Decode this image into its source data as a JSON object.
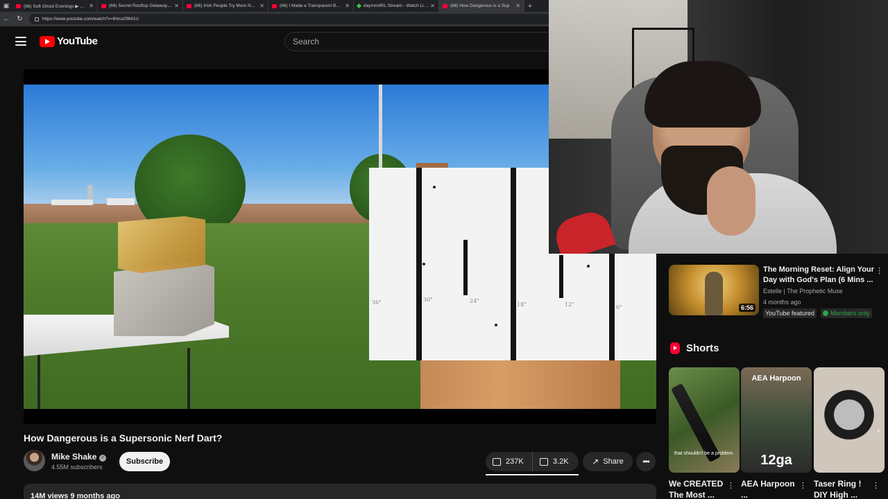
{
  "browser": {
    "tabs": [
      {
        "label": "(66) Soft Ghost Evenings ▶ Lofi B",
        "fav": "red"
      },
      {
        "label": "(66) Secret Rooftop Getaway With",
        "fav": "red"
      },
      {
        "label": "(66) Irish People Try More NEW F",
        "fav": "red"
      },
      {
        "label": "(66) I Made a Transparent Boome",
        "fav": "red"
      },
      {
        "label": "daymonIRL Stream - Watch Live o",
        "fav": "green"
      },
      {
        "label": "(66) How Dangerous is a Sup",
        "fav": "red"
      }
    ],
    "url": "https://www.youtube.com/watch?v=lHzuz09I41U"
  },
  "header": {
    "logo_text": "YouTube",
    "search_placeholder": "Search"
  },
  "video": {
    "title": "How Dangerous is a Supersonic Nerf Dart?",
    "distance_markers": [
      "36\"",
      "30\"",
      "24\"",
      "18\"",
      "12\"",
      "6\""
    ],
    "channel": {
      "name": "Mike Shake",
      "subscribers": "4.55M subscribers"
    },
    "subscribe_label": "Subscribe",
    "likes": "237K",
    "dislikes": "3.2K",
    "share_label": "Share",
    "more_label": "•••",
    "description_preview": "14M views  9 months ago"
  },
  "sidebar": {
    "video": {
      "title": "The Morning Reset: Align Your Day with God's Plan (6 Mins ...",
      "channel": "Estelle | The Prophetic Muse",
      "age": "4 months ago",
      "duration": "6:56",
      "badge_featured": "YouTube featured",
      "badge_members": "Members only"
    },
    "shorts_label": "Shorts",
    "shorts": [
      {
        "title": "We CREATED The Most ...",
        "overlay": "that shouldn't be a problem."
      },
      {
        "title": "AEA Harpoon ...",
        "overlay_top": "AEA Harpoon",
        "overlay_big": "12ga"
      },
      {
        "title": "Taser Ring ! DIY High ..."
      }
    ]
  },
  "colors": {
    "background": "#0f0f0f",
    "accent": "#ff0000",
    "members_badge": "#2ba640"
  }
}
